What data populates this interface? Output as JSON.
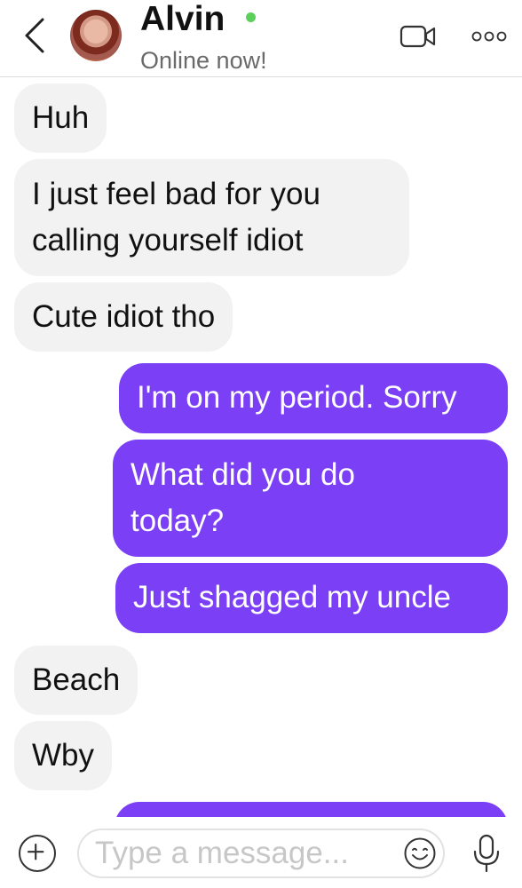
{
  "header": {
    "contact_name": "Alvin",
    "status": "Online now!",
    "online_color": "#5bd15b",
    "icons": {
      "back": "chevron-left-icon",
      "video": "video-camera-icon",
      "more": "more-dots-icon"
    }
  },
  "messages": [
    {
      "direction": "incoming",
      "lines": [
        "Huh"
      ]
    },
    {
      "direction": "incoming",
      "lines": [
        "I just feel bad for you",
        "calling yourself idiot"
      ]
    },
    {
      "direction": "incoming",
      "lines": [
        "Cute idiot tho"
      ]
    },
    {
      "direction": "outgoing",
      "lines": [
        "I'm on my period. Sorry"
      ]
    },
    {
      "direction": "outgoing",
      "lines": [
        "What did you do",
        "today?"
      ]
    },
    {
      "direction": "outgoing",
      "lines": [
        "Just shagged my uncle"
      ]
    },
    {
      "direction": "incoming",
      "lines": [
        "Beach"
      ]
    },
    {
      "direction": "incoming",
      "lines": [
        "Wby"
      ]
    },
    {
      "direction": "outgoing",
      "lines": []
    }
  ],
  "composer": {
    "placeholder": "Type a message...",
    "value": "",
    "icons": {
      "add": "plus-icon",
      "emoji": "emoji-icon",
      "mic": "microphone-icon"
    }
  },
  "colors": {
    "outgoing_bubble": "#7b3ff6",
    "incoming_bubble": "#f2f2f2"
  }
}
